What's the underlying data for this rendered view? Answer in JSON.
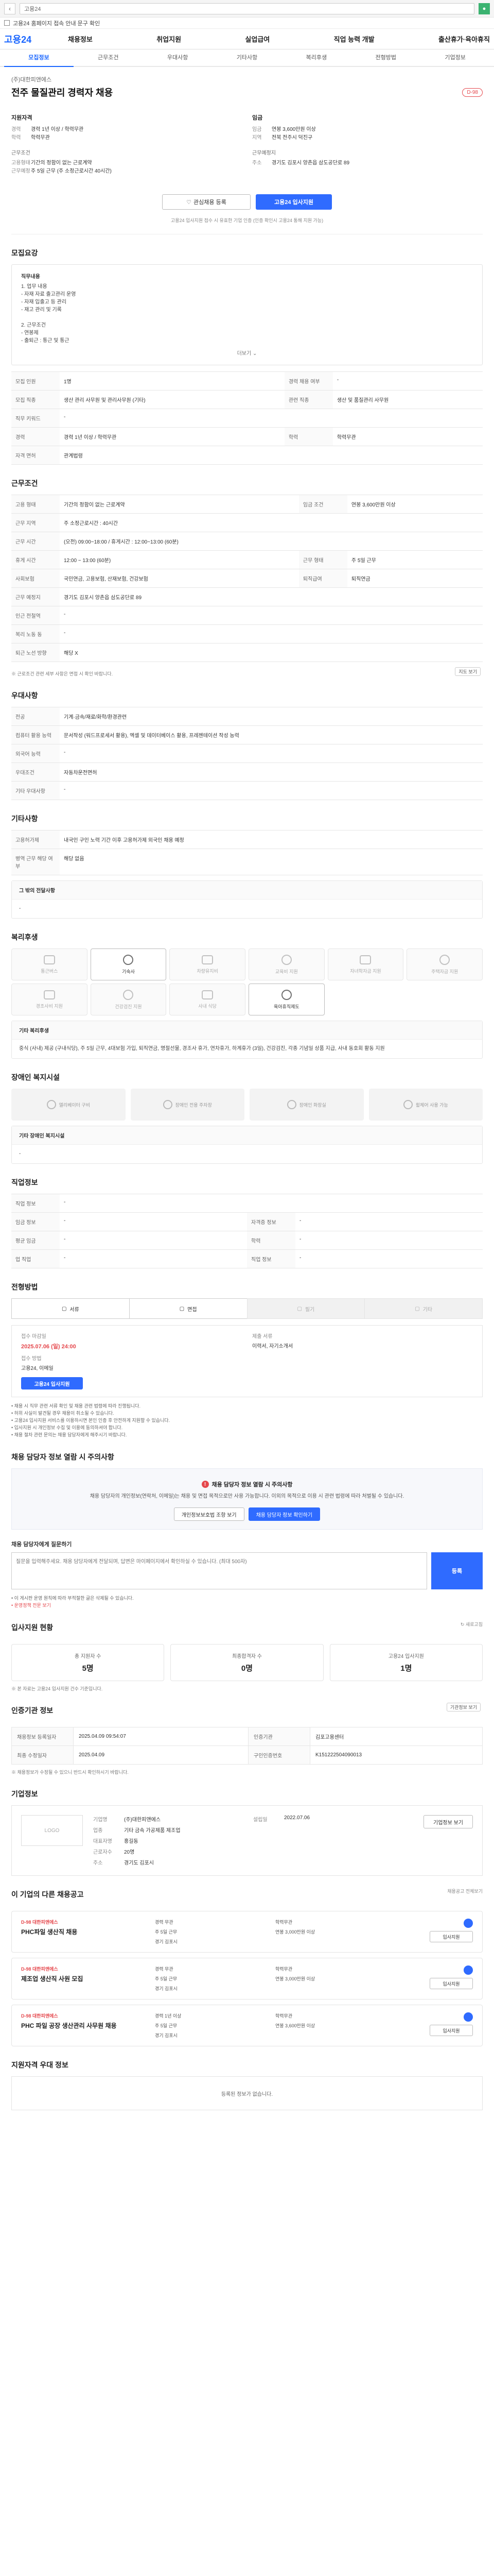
{
  "browser": {
    "url_text": "고용24",
    "notice": "고용24 홈페이지 접속 안내 문구 확인"
  },
  "header": {
    "logo": "고용24",
    "menu": [
      "채용정보",
      "취업지원",
      "실업급여",
      "직업 능력 개발",
      "출산휴가·육아휴직"
    ]
  },
  "tabs": [
    "모집정보",
    "근무조건",
    "우대사항",
    "기타사항",
    "복리후생",
    "전형방법",
    "기업정보"
  ],
  "hero": {
    "company": "(주)대한피앤에스",
    "title": "전주 물질관리 경력자 채용",
    "dday": "D-98",
    "req_title": "지원자격",
    "req": [
      {
        "k": "경력",
        "v": "경력 1년 이상 / 학력무관"
      },
      {
        "k": "학력",
        "v": "학력무관"
      }
    ],
    "cond_title": "근무조건",
    "cond": [
      {
        "k": "고용형태",
        "v": "기간의 정함이 없는 근로계약"
      },
      {
        "k": "근무예정",
        "v": "주 5일 근무 (주 소정근로시간 40시간)"
      }
    ],
    "wage_title": "임금",
    "wage": [
      {
        "k": "임금",
        "v": "연봉 3,600만원 이상"
      },
      {
        "k": "지역",
        "v": "전북 전주시 덕진구"
      }
    ],
    "workplace_title": "근무예정지",
    "workplace": [
      {
        "k": "주소",
        "v": "경기도 김포시 양촌읍 삼도공단로 89"
      }
    ],
    "btn_scrap": "관심채용 등록",
    "btn_apply": "고용24 입사지원",
    "note": "고용24 입사지원 접수 시 유효한 기업 인증 (인증 확인시 고용24 통해 지원 가능)"
  },
  "recruit": {
    "title": "모집요강",
    "duty_title": "직무내용",
    "duties": "1. 업무 내용\n- 자재 자료 출고관리 운영\n- 자재 입출고 등 관리\n- 재고 관리 및 기록\n\n2. 근무조건\n- 연봉제\n- 출퇴근 : 통근 및 통근",
    "more": "더보기",
    "rows": [
      {
        "k": "모집 인원",
        "v": "1명",
        "k2": "경력 채용 여부",
        "v2": "-"
      },
      {
        "k": "모집 직종",
        "v": "생산 관리 사무원 및 관리사무원 (기타)",
        "k2": "관련 직종",
        "v2": "생산 및 품질관리 사무원"
      },
      {
        "k": "직무 키워드",
        "v": "-",
        "k2": "",
        "v2": ""
      },
      {
        "k": "경력",
        "v": "경력 1년 이상 / 학력무관",
        "k2": "학력",
        "v2": "학력무관"
      },
      {
        "k": "자격 면허",
        "v": "관계법령",
        "k2": "",
        "v2": ""
      }
    ]
  },
  "work": {
    "title": "근무조건",
    "rows": [
      {
        "k": "고용 형태",
        "v": "기간의 정함이 없는 근로계약",
        "k2": "임금 조건",
        "v2": "연봉 3,600만원 이상"
      },
      {
        "k": "근무 지역",
        "v": "주 소정근로시간 : 40시간",
        "k2": "",
        "v2": ""
      },
      {
        "k": "근무 시간",
        "v": "(오전) 09:00~18:00 / 휴게시간 : 12:00~13:00 (60분)",
        "k2": "",
        "v2": ""
      },
      {
        "k": "휴게 시간",
        "v": "12:00 ~ 13:00 (60분)",
        "k2": "근무 형태",
        "v2": "주 5일 근무"
      },
      {
        "k": "사회보험",
        "v": "국민연금, 고용보험, 산재보험, 건강보험",
        "k2": "퇴직급여",
        "v2": "퇴직연금"
      },
      {
        "k": "근무 예정지",
        "v": "경기도 김포시 양촌읍 삼도공단로 89",
        "k2": "",
        "v2": ""
      },
      {
        "k": "인근 전철역",
        "v": "-",
        "k2": "",
        "v2": ""
      },
      {
        "k": "복리 노동 동",
        "v": "-",
        "k2": "",
        "v2": ""
      },
      {
        "k": "퇴근 노선 방향",
        "v": "해당 X",
        "k2": "",
        "v2": ""
      }
    ],
    "map_btn": "지도 보기",
    "note": "※ 근로조건 관련 세부 사항은 면접 시 확인 바랍니다."
  },
  "prefer": {
    "title": "우대사항",
    "rows": [
      {
        "k": "전공",
        "v": "기계·금속/재료/화학/환경관련"
      },
      {
        "k": "컴퓨터 활용 능력",
        "v": "문서작성 (워드프로세서 활용), 엑셀 및 데이터베이스 활용, 프레젠테이션 작성 능력"
      },
      {
        "k": "외국어 능력",
        "v": "-"
      },
      {
        "k": "우대조건",
        "v": "자동차운전면허"
      },
      {
        "k": "기타 우대사항",
        "v": "-"
      }
    ]
  },
  "etc": {
    "title": "기타사항",
    "rows": [
      {
        "k": "고용허가제",
        "v": "내국인 구인 노력 기간 이후 고용허가제 외국인 채용 예정"
      },
      {
        "k": "병역 근무 해당 여부",
        "v": "해당 없음"
      }
    ],
    "sub_title": "그 밖의 전달사항",
    "sub_body": "-"
  },
  "welfare": {
    "title": "복리후생",
    "items": [
      {
        "label": "통근버스",
        "on": false
      },
      {
        "label": "기숙사",
        "on": true
      },
      {
        "label": "차량유지비",
        "on": false
      },
      {
        "label": "교육비 지원",
        "on": false
      },
      {
        "label": "자녀학자금 지원",
        "on": false
      },
      {
        "label": "주택자금 지원",
        "on": false
      },
      {
        "label": "경조사비 지원",
        "on": false
      },
      {
        "label": "건강검진 지원",
        "on": false
      },
      {
        "label": "사내 식당",
        "on": false
      },
      {
        "label": "육아휴직제도",
        "on": true
      }
    ],
    "sub_title": "기타 복리후생",
    "sub_body": "중식 (사내) 제공 (구내식당), 주 5일 근무, 4대보험 가입, 퇴직연금, 명절선물, 경조사 휴가, 연차휴가, 하계휴가 (3일), 건강검진, 각종 기념일 상품 지급, 사내 동호회 활동 지원"
  },
  "disability": {
    "title": "장애인 복지시설",
    "items": [
      "엘리베이터 구비",
      "장애인 전용 주차장",
      "장애인 화장실",
      "휠체어 사용 가능"
    ],
    "sub_title": "기타 장애인 복지시설",
    "sub_body": "-"
  },
  "workinfo": {
    "title": "직업정보",
    "rows": [
      {
        "k": "직업 정보",
        "v": "-",
        "k2": "",
        "v2": ""
      },
      {
        "k": "임금 정보",
        "v": "-",
        "k2": "자격증 정보",
        "v2": "-"
      },
      {
        "k": "평균 임금",
        "v": "-",
        "k2": "학력",
        "v2": "-"
      },
      {
        "k": "업 직업",
        "v": "-",
        "k2": "직업 정보",
        "v2": "-"
      }
    ]
  },
  "selection": {
    "title": "전형방법",
    "steps": [
      {
        "label": "서류",
        "off": false
      },
      {
        "label": "면접",
        "off": false
      },
      {
        "label": "필기",
        "off": true
      },
      {
        "label": "기타",
        "off": true
      }
    ],
    "deadline_label": "접수 마감일",
    "deadline": "2025.07.06 (일) 24:00",
    "method_label": "접수 방법",
    "method": "고용24, 이메일",
    "docs_label": "제출 서류",
    "docs": "이력서, 자기소개서",
    "apply_btn": "고용24 입사지원",
    "bullets": [
      "채용 시 직무 관련 서류 확인 및 채용 관련 법령에 따라 진행됩니다.",
      "허위 사실이 발견될 경우 채용이 취소될 수 있습니다.",
      "고용24 입사지원 서비스를 이용하시면 본인 인증 후 안전하게 지원할 수 있습니다.",
      "입사지원 시 개인정보 수집 및 이용에 동의하셔야 합니다.",
      "채용 절차 관련 문의는 채용 담당자에게 해주시기 바랍니다."
    ]
  },
  "caution": {
    "title": "채용 담당자 정보 열람 시 주의사항",
    "warn_title": "채용 담당자 정보 열람 시 주의사항",
    "warn_text": "채용 담당자의 개인정보(연락처, 이메일)는 채용 및 면접 목적으로만 사용 가능합니다. 이외의 목적으로 이용 시 관련 법령에 따라 처벌될 수 있습니다.",
    "btn1": "개인정보보호법 조항 보기",
    "btn2": "채용 담당자 정보 확인하기"
  },
  "question": {
    "title": "채용 담당자에게 질문하기",
    "placeholder": "질문을 입력해주세요. 채용 담당자에게 전달되며, 답변은 마이페이지에서 확인하실 수 있습니다. (최대 500자)",
    "btn": "등록",
    "notes": [
      "이 게시판 운영 원칙에 따라 부적절한 글은 삭제될 수 있습니다.",
      "운영정책 전문 보기"
    ]
  },
  "stats": {
    "title": "입사지원 현황",
    "refresh": "새로고침",
    "items": [
      {
        "label": "총 지원자 수",
        "num": "5명"
      },
      {
        "label": "최종합격자 수",
        "num": "0명"
      },
      {
        "label": "고용24 입사지원",
        "num": "1명"
      }
    ],
    "note": "※ 본 자료는 고용24 입사지원 건수 기준입니다."
  },
  "info": {
    "title": "인증기관 정보",
    "btn": "기관정보 보기",
    "rows": [
      {
        "k": "채용정보 등록일자",
        "v": "2025.04.09 09:54:07",
        "k2": "인증기관",
        "v2": "김포고용센터"
      },
      {
        "k": "최종 수정일자",
        "v": "2025.04.09",
        "k2": "구인인증번호",
        "v2": "K151222504090013"
      }
    ],
    "note": "※ 채용정보가 수정될 수 있으니 반드시 확인하시기 바랍니다."
  },
  "company": {
    "title": "기업정보",
    "logo": "LOGO",
    "rows": [
      {
        "k": "기업명",
        "v": "(주)대한피앤에스",
        "k2": "설립일",
        "v2": "2022.07.06"
      },
      {
        "k": "업종",
        "v": "기타 금속 가공제품 제조업",
        "k2": "",
        "v2": ""
      },
      {
        "k": "대표자명",
        "v": "홍길동",
        "k2": "",
        "v2": ""
      },
      {
        "k": "근로자수",
        "v": "20명",
        "k2": "",
        "v2": ""
      },
      {
        "k": "주소",
        "v": "경기도 김포시",
        "k2": "",
        "v2": ""
      }
    ],
    "btn": "기업정보 보기"
  },
  "others": {
    "title": "이 기업의 다른 채용공고",
    "more": "채용공고 전체보기",
    "jobs": [
      {
        "company": "대한피앤에스",
        "title": "PHC파일 생산직 채용",
        "d": "D-98",
        "info": [
          "경력 무관",
          "학력무관",
          "주 5일 근무",
          "연봉 3,000만원 이상",
          "경기 김포시"
        ],
        "btn": "입사지원"
      },
      {
        "company": "대한피앤에스",
        "title": "제조업 생산직 사원 모집",
        "d": "D-98",
        "info": [
          "경력 무관",
          "학력무관",
          "주 5일 근무",
          "연봉 3,000만원 이상",
          "경기 김포시"
        ],
        "btn": "입사지원"
      },
      {
        "company": "대한피앤에스",
        "title": "PHC 파일 공장 생산관리 사무원 채용",
        "d": "D-98",
        "info": [
          "경력 1년 이상",
          "학력무관",
          "주 5일 근무",
          "연봉 3,600만원 이상",
          "경기 김포시"
        ],
        "btn": "입사지원"
      }
    ]
  },
  "footer_box": {
    "title": "지원자격 우대 정보",
    "text": "등록된 정보가 없습니다."
  }
}
